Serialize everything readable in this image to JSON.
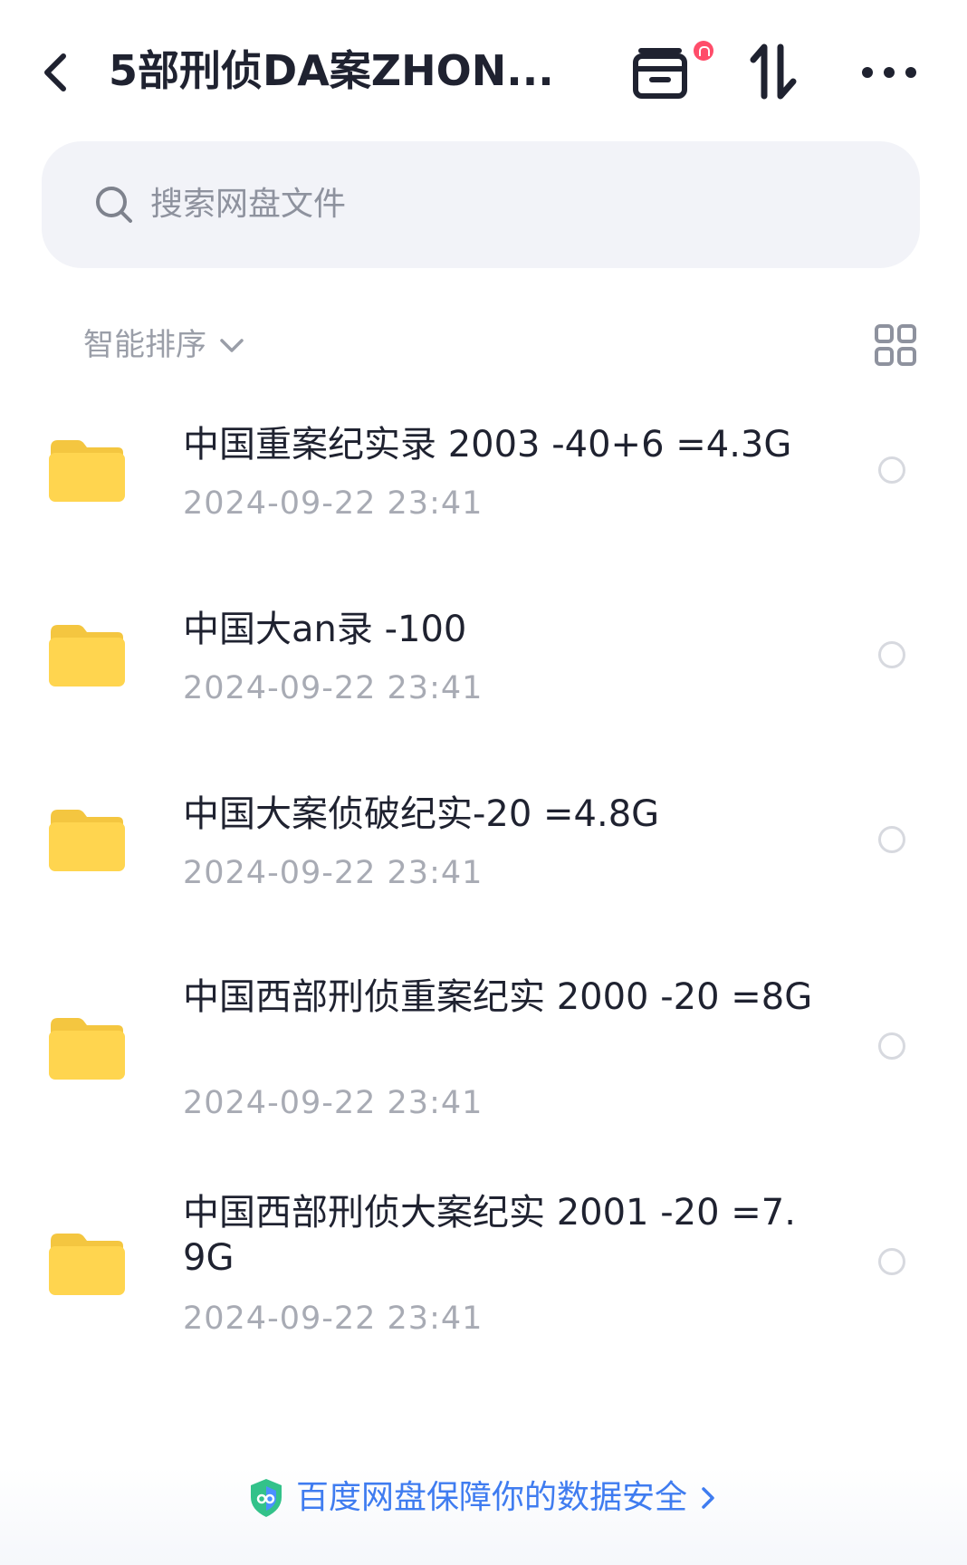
{
  "header": {
    "title": "5部刑侦DA案ZHON..."
  },
  "search": {
    "placeholder": "搜索网盘文件"
  },
  "sort": {
    "label": "智能排序"
  },
  "files": [
    {
      "name": "中国重案纪实录   2003 -40+6 =4.3G",
      "date": "2024-09-22  23:41"
    },
    {
      "name": "中国大an录 -100",
      "date": "2024-09-22  23:41"
    },
    {
      "name": "中国大案侦破纪实-20 =4.8G",
      "date": "2024-09-22  23:41"
    },
    {
      "name": "中国西部刑侦重案纪实  2000  -20 =8G",
      "date": "2024-09-22  23:41"
    },
    {
      "name": "中国西部刑侦大案纪实  2001  -20 =7.9G",
      "date": "2024-09-22  23:41"
    }
  ],
  "banner": {
    "text": "百度网盘保障你的数据安全"
  },
  "colors": {
    "accent": "#3f7cf0",
    "folder": "#ffd54f",
    "notification": "#ff4d6a"
  },
  "icons": {
    "back": "back-arrow-icon",
    "transfer": "transfer-box-icon",
    "sort_order": "sort-arrows-icon",
    "more": "more-dots-icon",
    "search": "search-icon",
    "grid": "grid-view-icon",
    "folder": "folder-icon",
    "shield": "shield-icon"
  }
}
